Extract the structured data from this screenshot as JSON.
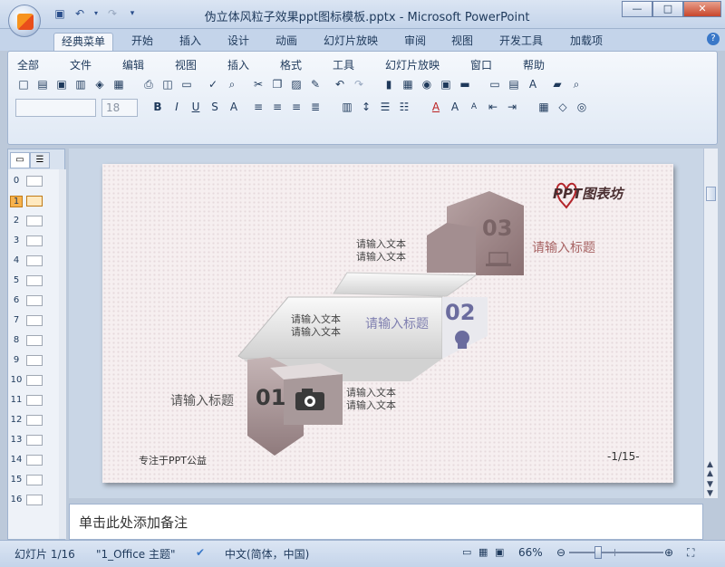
{
  "window": {
    "title": "伪立体风粒子效果ppt图标模板.pptx - Microsoft PowerPoint",
    "minimize": "—",
    "maximize": "□",
    "close": "✕"
  },
  "ribbon_tabs": [
    "经典菜单",
    "开始",
    "插入",
    "设计",
    "动画",
    "幻灯片放映",
    "审阅",
    "视图",
    "开发工具",
    "加载项"
  ],
  "classic_menu": [
    "全部",
    "文件",
    "编辑",
    "视图",
    "插入",
    "格式",
    "工具",
    "幻灯片放映",
    "窗口",
    "帮助"
  ],
  "font_size_placeholder": "18",
  "slides_panel": {
    "numbers": [
      "0",
      "1",
      "2",
      "3",
      "4",
      "5",
      "6",
      "7",
      "8",
      "9",
      "10",
      "11",
      "12",
      "13",
      "14",
      "15",
      "16"
    ],
    "selected": "1"
  },
  "slide": {
    "logo": "PPT图表坊",
    "step1": {
      "number": "01",
      "title": "请输入标题",
      "text1": "请输入文本",
      "text2": "请输入文本"
    },
    "step2": {
      "number": "02",
      "title": "请输入标题",
      "text1": "请输入文本",
      "text2": "请输入文本"
    },
    "step3": {
      "number": "03",
      "title": "请输入标题",
      "text1": "请输入文本",
      "text2": "请输入文本"
    },
    "footer_left": "专注于PPT公益",
    "page": "-1/15-"
  },
  "notes_placeholder": "单击此处添加备注",
  "status": {
    "slide": "幻灯片 1/16",
    "theme": "\"1_Office 主题\"",
    "language": "中文(简体，中国)",
    "zoom": "66%"
  },
  "colors": {
    "accent_brown": "#8d7173",
    "accent_purple": "#6b6c9e",
    "title_red": "#a86464",
    "ribbon": "#c4d4ea"
  }
}
